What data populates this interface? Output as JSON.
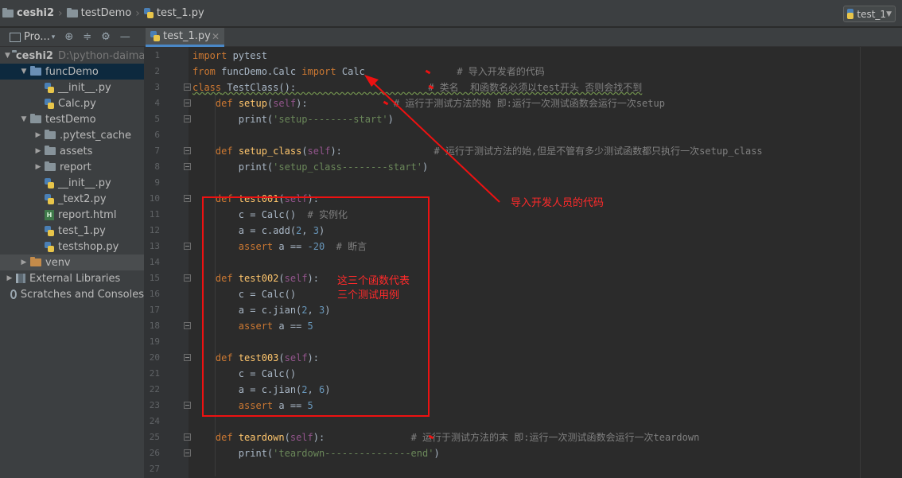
{
  "navbar": {
    "project": "ceshi2",
    "folder": "testDemo",
    "file": "test_1.py",
    "run_config": "test_1"
  },
  "project_panel": {
    "title": "Pro...",
    "tree": [
      {
        "label": "ceshi2",
        "hint": "D:\\python-daima",
        "indent": 0,
        "arrow": "open",
        "icon": "folder"
      },
      {
        "label": "funcDemo",
        "indent": 1,
        "arrow": "open",
        "icon": "folder",
        "selected": true
      },
      {
        "label": "__init__.py",
        "indent": 2,
        "icon": "python"
      },
      {
        "label": "Calc.py",
        "indent": 2,
        "icon": "python"
      },
      {
        "label": "testDemo",
        "indent": 1,
        "arrow": "open",
        "icon": "folder"
      },
      {
        "label": ".pytest_cache",
        "indent": 2,
        "arrow": "closed",
        "icon": "folder"
      },
      {
        "label": "assets",
        "indent": 2,
        "arrow": "closed",
        "icon": "folder"
      },
      {
        "label": "report",
        "indent": 2,
        "arrow": "closed",
        "icon": "folder"
      },
      {
        "label": "__init__.py",
        "indent": 2,
        "icon": "python"
      },
      {
        "label": "_text2.py",
        "indent": 2,
        "icon": "python"
      },
      {
        "label": "report.html",
        "indent": 2,
        "icon": "html"
      },
      {
        "label": "test_1.py",
        "indent": 2,
        "icon": "python"
      },
      {
        "label": "testshop.py",
        "indent": 2,
        "icon": "python"
      },
      {
        "label": "venv",
        "indent": 1,
        "arrow": "closed",
        "icon": "folder-orange",
        "shaded": true
      },
      {
        "label": "External Libraries",
        "indent": 0,
        "arrow": "closed",
        "icon": "library"
      },
      {
        "label": "Scratches and Consoles",
        "indent": 0,
        "icon": "scratch"
      }
    ]
  },
  "tab": {
    "label": "test_1.py"
  },
  "editor": {
    "lines": [
      {
        "n": "1",
        "t": [
          [
            "kw",
            "import"
          ],
          [
            "",
            " pytest"
          ]
        ]
      },
      {
        "n": "2",
        "t": [
          [
            "kw",
            "from"
          ],
          [
            "",
            " funcDemo.Calc "
          ],
          [
            "kw",
            "import"
          ],
          [
            "",
            " Calc                "
          ],
          [
            "cm",
            "# 导入开发者的代码"
          ]
        ]
      },
      {
        "n": "3",
        "t": [
          [
            "kw",
            "class"
          ],
          [
            "",
            " TestClass():                       "
          ],
          [
            "cm",
            "# 类名  和函数名必须以test开头 否则会找不到"
          ]
        ]
      },
      {
        "n": "4",
        "t": [
          [
            "",
            "    "
          ],
          [
            "kw",
            "def"
          ],
          [
            "",
            " "
          ],
          [
            "fn",
            "setup"
          ],
          [
            "",
            "("
          ],
          [
            "self",
            "self"
          ],
          [
            "",
            "):               "
          ],
          [
            "cm",
            "# 运行于测试方法的始 即:运行一次测试函数会运行一次setup"
          ]
        ]
      },
      {
        "n": "5",
        "t": [
          [
            "",
            "        print("
          ],
          [
            "str",
            "'setup--------start'"
          ],
          [
            "",
            ")"
          ]
        ]
      },
      {
        "n": "6",
        "t": []
      },
      {
        "n": "7",
        "t": [
          [
            "",
            "    "
          ],
          [
            "kw",
            "def"
          ],
          [
            "",
            " "
          ],
          [
            "fn",
            "setup_class"
          ],
          [
            "",
            "("
          ],
          [
            "self",
            "self"
          ],
          [
            "",
            "):                "
          ],
          [
            "cm",
            "# 运行于测试方法的始,但是不管有多少测试函数都只执行一次setup_class"
          ]
        ]
      },
      {
        "n": "8",
        "t": [
          [
            "",
            "        print("
          ],
          [
            "str",
            "'setup_class--------start'"
          ],
          [
            "",
            ")"
          ]
        ]
      },
      {
        "n": "9",
        "t": []
      },
      {
        "n": "10",
        "t": [
          [
            "",
            "    "
          ],
          [
            "kw",
            "def"
          ],
          [
            "",
            " "
          ],
          [
            "fn",
            "test001"
          ],
          [
            "",
            "("
          ],
          [
            "self",
            "self"
          ],
          [
            "",
            "):"
          ]
        ]
      },
      {
        "n": "11",
        "t": [
          [
            "",
            "        c = Calc()  "
          ],
          [
            "cm",
            "# 实例化"
          ]
        ]
      },
      {
        "n": "12",
        "t": [
          [
            "",
            "        a = c.add("
          ],
          [
            "num",
            "2"
          ],
          [
            "",
            ", "
          ],
          [
            "num",
            "3"
          ],
          [
            "",
            ")"
          ]
        ]
      },
      {
        "n": "13",
        "t": [
          [
            "",
            "        "
          ],
          [
            "kw",
            "assert"
          ],
          [
            "",
            " a == "
          ],
          [
            "num",
            "-20"
          ],
          [
            "",
            "  "
          ],
          [
            "cm",
            "# 断言"
          ]
        ]
      },
      {
        "n": "14",
        "t": []
      },
      {
        "n": "15",
        "t": [
          [
            "",
            "    "
          ],
          [
            "kw",
            "def"
          ],
          [
            "",
            " "
          ],
          [
            "fn",
            "test002"
          ],
          [
            "",
            "("
          ],
          [
            "self",
            "self"
          ],
          [
            "",
            "):"
          ]
        ]
      },
      {
        "n": "16",
        "t": [
          [
            "",
            "        c = Calc()"
          ]
        ]
      },
      {
        "n": "17",
        "t": [
          [
            "",
            "        a = c.jian("
          ],
          [
            "num",
            "2"
          ],
          [
            "",
            ", "
          ],
          [
            "num",
            "3"
          ],
          [
            "",
            ")"
          ]
        ]
      },
      {
        "n": "18",
        "t": [
          [
            "",
            "        "
          ],
          [
            "kw",
            "assert"
          ],
          [
            "",
            " a == "
          ],
          [
            "num",
            "5"
          ]
        ]
      },
      {
        "n": "19",
        "t": []
      },
      {
        "n": "20",
        "t": [
          [
            "",
            "    "
          ],
          [
            "kw",
            "def"
          ],
          [
            "",
            " "
          ],
          [
            "fn",
            "test003"
          ],
          [
            "",
            "("
          ],
          [
            "self",
            "self"
          ],
          [
            "",
            "):"
          ]
        ]
      },
      {
        "n": "21",
        "t": [
          [
            "",
            "        c = Calc()"
          ]
        ]
      },
      {
        "n": "22",
        "t": [
          [
            "",
            "        a = c.jian("
          ],
          [
            "num",
            "2"
          ],
          [
            "",
            ", "
          ],
          [
            "num",
            "6"
          ],
          [
            "",
            ")"
          ]
        ]
      },
      {
        "n": "23",
        "t": [
          [
            "",
            "        "
          ],
          [
            "kw",
            "assert"
          ],
          [
            "",
            " a == "
          ],
          [
            "num",
            "5"
          ]
        ]
      },
      {
        "n": "24",
        "t": []
      },
      {
        "n": "25",
        "t": [
          [
            "",
            "    "
          ],
          [
            "kw",
            "def"
          ],
          [
            "",
            " "
          ],
          [
            "fn",
            "teardown"
          ],
          [
            "",
            "("
          ],
          [
            "self",
            "self"
          ],
          [
            "",
            "):               "
          ],
          [
            "cm",
            "# 运行于测试方法的末 即:运行一次测试函数会运行一次teardown"
          ]
        ]
      },
      {
        "n": "26",
        "t": [
          [
            "",
            "        print("
          ],
          [
            "str",
            "'teardown---------------end'"
          ],
          [
            "",
            ")"
          ]
        ]
      },
      {
        "n": "27",
        "t": []
      }
    ]
  },
  "annotations": {
    "arrow_label": "导入开发人员的代码",
    "box_label_line1": "这三个函数代表",
    "box_label_line2": "三个测试用例",
    "color": "#ee1111"
  }
}
